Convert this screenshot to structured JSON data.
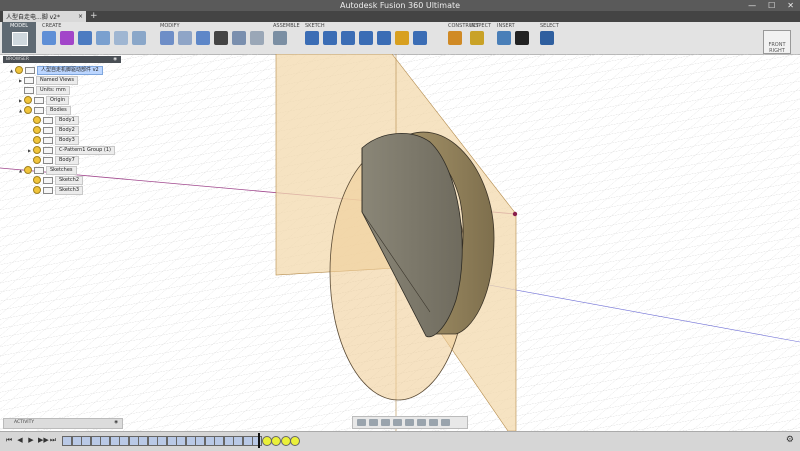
{
  "window": {
    "title": "Autodesk Fusion 360 Ultimate",
    "controls": [
      "—",
      "☐",
      "✕"
    ]
  },
  "tab": {
    "name": "人型自走电...脚 v2*",
    "close": "×",
    "add": "+"
  },
  "toolbar": {
    "workspace": "MODEL",
    "groups": [
      {
        "label": "CREATE",
        "tools": [
          "box-icon",
          "sphere-icon",
          "revolve-icon",
          "cylinder-icon",
          "extrude-icon",
          "shell-icon"
        ],
        "colors": [
          "#5f8fd6",
          "#a245c9",
          "#4c7bc1",
          "#7aa0cf",
          "#9fb6d2",
          "#8aa7c9"
        ]
      },
      {
        "label": "MODIFY",
        "tools": [
          "press-pull-icon",
          "fillet-icon",
          "combine-icon",
          "move-icon",
          "align-icon",
          "shell-body-icon"
        ],
        "colors": [
          "#6e8ec7",
          "#8fa5c7",
          "#5e87c8",
          "#444",
          "#7a8fae",
          "#9aa7b7"
        ]
      },
      {
        "label": "ASSEMBLE",
        "tools": [
          "joint-icon"
        ],
        "colors": [
          "#7b8fa3"
        ]
      },
      {
        "label": "SKETCH",
        "tools": [
          "sketch-line-icon",
          "arc-icon",
          "trim-icon",
          "offset-icon",
          "project-icon",
          "stop-sketch-icon",
          "spline-icon"
        ],
        "colors": [
          "#3b6db5",
          "#3b6db5",
          "#3b6db5",
          "#3b6db5",
          "#3b6db5",
          "#d8a020",
          "#3b6db5"
        ]
      },
      {
        "label": "CONSTRUCT",
        "tools": [
          "plane-icon"
        ],
        "colors": [
          "#d08a25"
        ]
      },
      {
        "label": "INSPECT",
        "tools": [
          "measure-icon"
        ],
        "colors": [
          "#c9a227"
        ]
      },
      {
        "label": "INSERT",
        "tools": [
          "insert-image-icon",
          "decal-icon"
        ],
        "colors": [
          "#4a7fb8",
          "#222"
        ]
      },
      {
        "label": "SELECT",
        "tools": [
          "select-icon"
        ],
        "colors": [
          "#2f5f9f"
        ]
      }
    ]
  },
  "viewcube": {
    "label": "FRONT RIGHT"
  },
  "browser": {
    "title": "BROWSER",
    "nodes": [
      {
        "label": "人型自走机脚驱动部件 v2",
        "level": 0,
        "root": true,
        "arrow": "▲",
        "bulb": true
      },
      {
        "label": "Named Views",
        "level": 1,
        "arrow": "▶",
        "bulb": false
      },
      {
        "label": "Units: mm",
        "level": 1,
        "arrow": "",
        "bulb": false
      },
      {
        "label": "Origin",
        "level": 1,
        "arrow": "▶",
        "bulb": true
      },
      {
        "label": "Bodies",
        "level": 1,
        "arrow": "▲",
        "bulb": true
      },
      {
        "label": "Body1",
        "level": 2,
        "arrow": "",
        "bulb": true
      },
      {
        "label": "Body2",
        "level": 2,
        "arrow": "",
        "bulb": true
      },
      {
        "label": "Body3",
        "level": 2,
        "arrow": "",
        "bulb": true
      },
      {
        "label": "C-Pattern1 Group (1)",
        "level": 2,
        "arrow": "▶",
        "bulb": true
      },
      {
        "label": "Body7",
        "level": 2,
        "arrow": "",
        "bulb": true
      },
      {
        "label": "Sketches",
        "level": 1,
        "arrow": "▲",
        "bulb": true
      },
      {
        "label": "Sketch2",
        "level": 2,
        "arrow": "",
        "bulb": true
      },
      {
        "label": "Sketch3",
        "level": 2,
        "arrow": "",
        "bulb": true
      }
    ]
  },
  "activity": {
    "label": "ACTIVITY"
  },
  "timeline": {
    "playback": [
      "⏮",
      "◀",
      "▶",
      "▶▶",
      "⏭"
    ],
    "items": [
      "feat",
      "feat",
      "feat",
      "feat",
      "feat",
      "feat",
      "feat",
      "feat",
      "feat",
      "feat",
      "feat",
      "feat",
      "feat",
      "feat",
      "feat",
      "feat",
      "feat",
      "feat",
      "feat",
      "feat",
      "feat",
      "sketch",
      "sketch",
      "sketch",
      "sketch"
    ],
    "gear": "⚙"
  }
}
